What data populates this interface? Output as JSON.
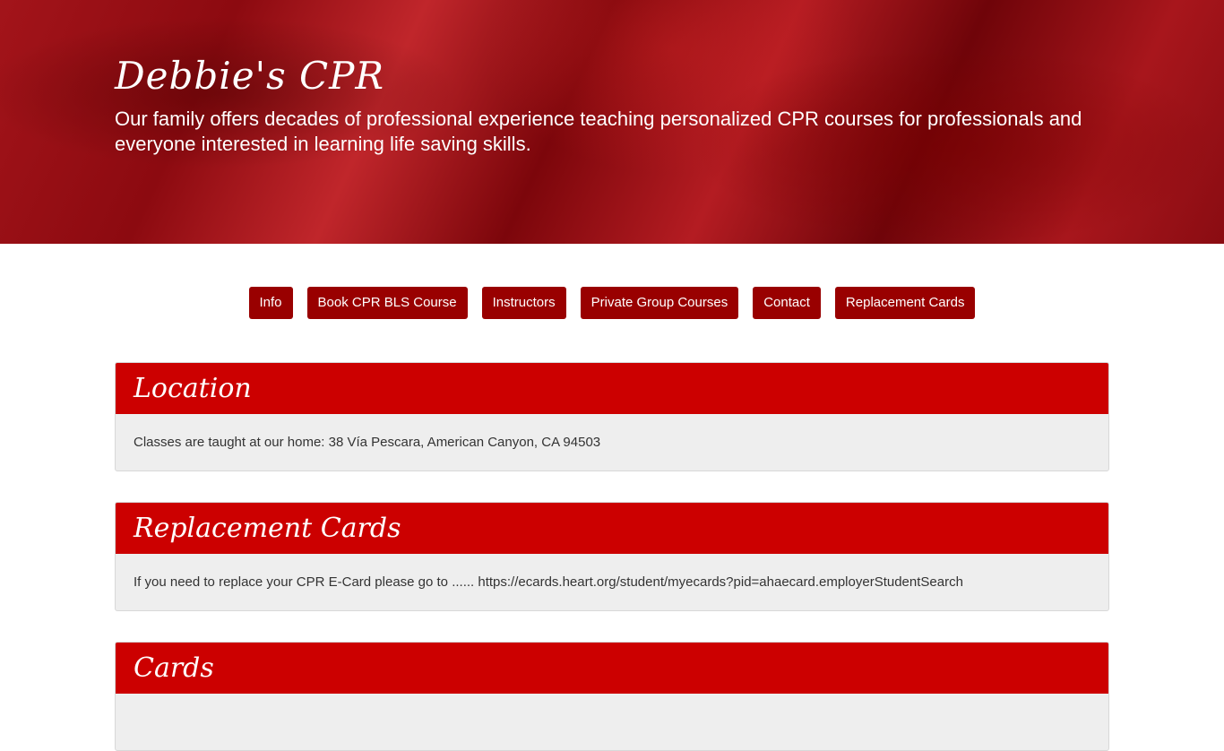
{
  "hero": {
    "title": "Debbie's CPR",
    "tagline": "Our family offers decades of professional experience teaching personalized CPR courses for professionals and everyone interested in learning life saving skills."
  },
  "nav": [
    {
      "label": "Info"
    },
    {
      "label": "Book CPR BLS Course"
    },
    {
      "label": "Instructors"
    },
    {
      "label": "Private Group Courses"
    },
    {
      "label": "Contact"
    },
    {
      "label": "Replacement Cards"
    }
  ],
  "panels": [
    {
      "title": "Location",
      "body": "Classes are taught at our home: 38 Vía Pescara, American Canyon, CA 94503"
    },
    {
      "title": "Replacement Cards",
      "body": "If you need to replace your CPR E-Card please go to ...... https://ecards.heart.org/student/myecards?pid=ahaecard.employerStudentSearch"
    },
    {
      "title": "Cards",
      "body": ""
    }
  ],
  "colors": {
    "nav_button": "#990000",
    "panel_header": "#cc0000",
    "panel_body": "#eeeeee"
  }
}
